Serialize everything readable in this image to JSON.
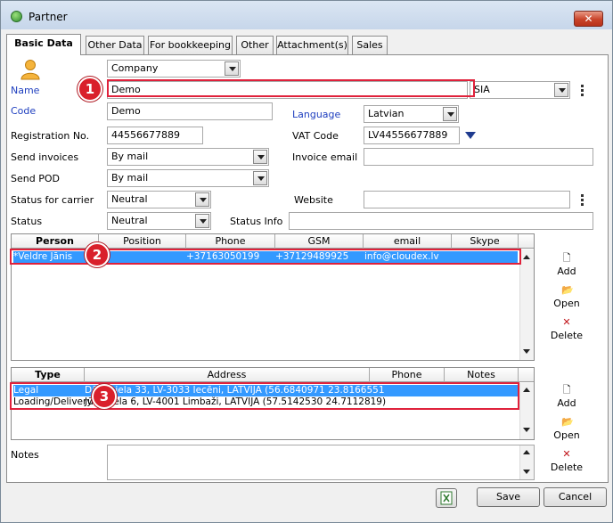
{
  "window": {
    "title": "Partner",
    "close_label": "✕"
  },
  "tabs": [
    "Basic Data",
    "Other Data",
    "For bookkeeping",
    "Other",
    "Attachment(s)",
    "Sales"
  ],
  "form": {
    "partner_type": "Company",
    "name_label": "Name",
    "name_value": "Demo",
    "legal_form": "SIA",
    "code_label": "Code",
    "code_value": "Demo",
    "language_label": "Language",
    "language_value": "Latvian",
    "reg_label": "Registration No.",
    "reg_value": "44556677889",
    "vat_label": "VAT Code",
    "vat_value": "LV44556677889",
    "send_invoices_label": "Send invoices",
    "send_invoices_value": "By mail",
    "invoice_email_label": "Invoice email",
    "invoice_email_value": "",
    "send_pod_label": "Send POD",
    "send_pod_value": "By mail",
    "status_carrier_label": "Status for carrier",
    "status_carrier_value": "Neutral",
    "website_label": "Website",
    "website_value": "",
    "status_label": "Status",
    "status_value": "Neutral",
    "status_info_label": "Status Info",
    "status_info_value": "",
    "notes_label": "Notes",
    "notes_value": ""
  },
  "persons": {
    "columns": [
      "Person",
      "Position",
      "Phone",
      "GSM",
      "email",
      "Skype"
    ],
    "rows": [
      {
        "person": "*Veldre Jānis",
        "position": "",
        "phone": "+37163050199",
        "gsm": "+37129489925",
        "email": "info@cloudex.lv",
        "skype": ""
      }
    ]
  },
  "addresses": {
    "columns": [
      "Type",
      "Address",
      "Phone",
      "Notes"
    ],
    "rows": [
      {
        "type": "Legal",
        "address": "Dārzu iela 33, LV-3033 Iecēni, LATVIJA (56.6840971 23.8166551"
      },
      {
        "type": "Loading/Delivery",
        "address": "Jūras iela 6, LV-4001 Limbaži, LATVIJA (57.5142530 24.7112819)"
      }
    ]
  },
  "side_actions": {
    "add": "Add",
    "open": "Open",
    "delete": "Delete"
  },
  "buttons": {
    "save": "Save",
    "cancel": "Cancel"
  },
  "callouts": [
    "1",
    "2",
    "3"
  ]
}
